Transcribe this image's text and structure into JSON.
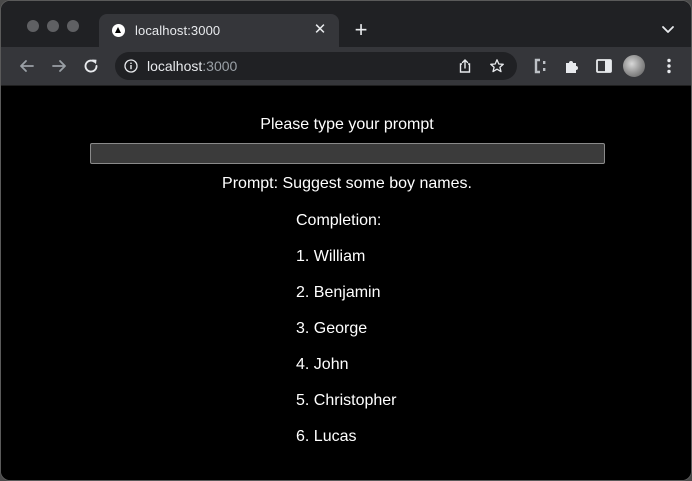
{
  "browser": {
    "tab": {
      "title": "localhost:3000",
      "close_glyph": "✕"
    },
    "new_tab_glyph": "+",
    "address_bar": {
      "host": "localhost",
      "port": ":3000"
    },
    "icons": [
      "back-arrow-icon",
      "forward-arrow-icon",
      "reload-icon",
      "info-icon",
      "share-icon",
      "star-icon",
      "extension-icon",
      "puzzle-icon",
      "side-panel-icon",
      "profile-avatar",
      "menu-dots-icon",
      "tab-search-chevron-icon"
    ]
  },
  "page": {
    "prompt_label": "Please type your prompt",
    "prompt_input_value": "",
    "prompt_echo": "Prompt: Suggest some boy names.",
    "completion_heading": "Completion:",
    "completion_items": [
      "1. William",
      "2. Benjamin",
      "3. George",
      "4. John",
      "5. Christopher",
      "6. Lucas"
    ]
  },
  "colors": {
    "page_background": "#000000",
    "text": "#ffffff",
    "input_background": "#3b3b3b",
    "chrome_dark": "#202124",
    "chrome_toolbar": "#35363a"
  }
}
